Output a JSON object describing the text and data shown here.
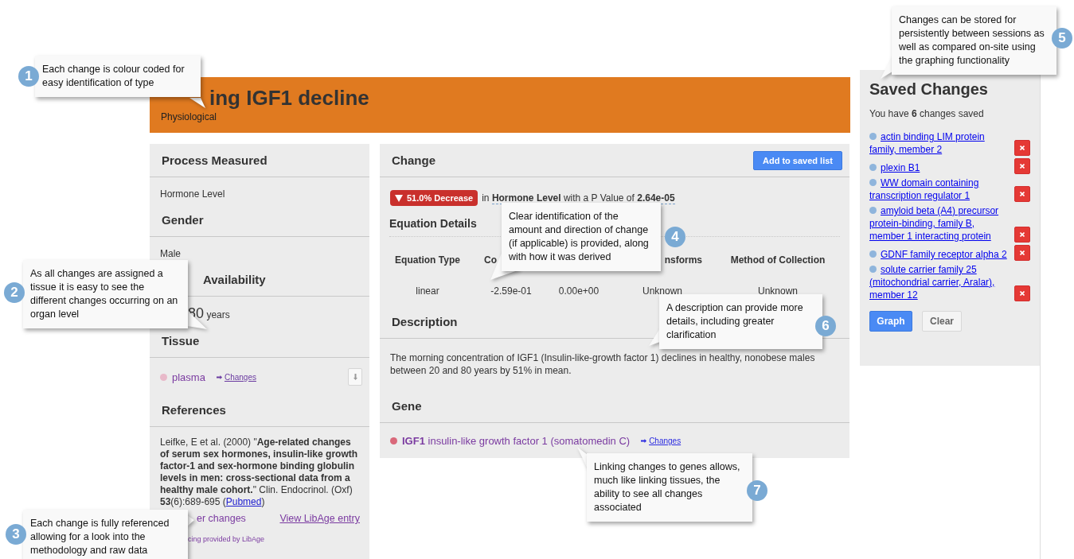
{
  "header": {
    "title": "ing IGF1 decline",
    "type": "Physiological"
  },
  "left_panel": {
    "process_measured": {
      "heading": "Process Measured",
      "value": "Hormone Level"
    },
    "gender": {
      "heading": "Gender",
      "value": "Male"
    },
    "availability": {
      "heading": "Availability",
      "number": "80",
      "unit": "years"
    },
    "tissue": {
      "heading": "Tissue",
      "items": [
        {
          "name": "plasma",
          "color": "#e8b9c9",
          "changes_link": "Changes"
        }
      ]
    },
    "references": {
      "heading": "References",
      "citation": "Leifke, E et al. (2000) \"**Age-related changes of serum sex hormones, insulin-like growth factor-1 and sex-hormone binding globulin levels in men: cross-sectional data from a healthy male cohort.**\" Clin. Endocrinol. (Oxf) **53**(6):689-695 (",
      "pubmed_link": "Pubmed",
      "citation_end": ")",
      "other_changes_link": "er changes",
      "libage_link": "View LibAge entry",
      "sourcing": "cing provided by LibAge"
    }
  },
  "change_panel": {
    "heading": "Change",
    "add_button": "Add to saved list",
    "badge": {
      "label": "51.0% Decrease"
    },
    "sentence": "in **Hormone Level** with a P Value of **2.64e-05**",
    "equation_heading": "Equation Details",
    "table": {
      "columns": [
        "Equation Type",
        "Co",
        null,
        "nsforms",
        "Method of Collection"
      ],
      "rows": [
        [
          "linear",
          "-2.59e-01",
          "0.00e+00",
          "Unknown",
          "Unknown"
        ]
      ]
    },
    "description_heading": "Description",
    "description": "The morning concentration of IGF1 (Insulin-like-growth factor 1) declines in healthy, nonobese males between 20 and 80 years by 51% in mean.",
    "gene_heading": "Gene",
    "genes": [
      {
        "name": "**IGF1** insulin-like growth factor 1 (somatomedin C)",
        "color": "#d9687a",
        "changes_link": "Changes"
      }
    ]
  },
  "saved_panel": {
    "heading": "Saved Changes",
    "summary": "You have **6** changes saved",
    "items": [
      {
        "label": "actin binding LIM protein family, member 2",
        "color": "#8fb5dc"
      },
      {
        "label": "plexin B1",
        "color": "#8fb5dc"
      },
      {
        "label": "WW domain containing transcription regulator 1",
        "color": "#8fb5dc"
      },
      {
        "label": "amyloid beta (A4) precursor protein-binding, family B, member 1 interacting protein",
        "color": "#8fb5dc"
      },
      {
        "label": "GDNF family receptor alpha 2",
        "color": "#8fb5dc"
      },
      {
        "label": "solute carrier family 25 (mitochondrial carrier, Aralar), member 12",
        "color": "#8fb5dc"
      }
    ],
    "graph_button": "Graph",
    "clear_button": "Clear"
  },
  "callouts": [
    {
      "number": "1",
      "text": "Each change is colour coded for easy identification of type"
    },
    {
      "number": "2",
      "text": "As all changes are assigned a tissue it is easy to see the different changes occurring on an organ level"
    },
    {
      "number": "3",
      "text": "Each change is fully referenced allowing for a look into the methodology and raw data"
    },
    {
      "number": "4",
      "text": "Clear identification of the amount and direction of change (if applicable) is provided, along with how it was derived"
    },
    {
      "number": "5",
      "text": "Changes can be stored for persistently between sessions as well as compared on-site using the graphing functionality"
    },
    {
      "number": "6",
      "text": "A description can provide more details, including greater clarification"
    },
    {
      "number": "7",
      "text": "Linking changes to genes allows, much like linking tissues, the ability to see all changes associated"
    }
  ]
}
